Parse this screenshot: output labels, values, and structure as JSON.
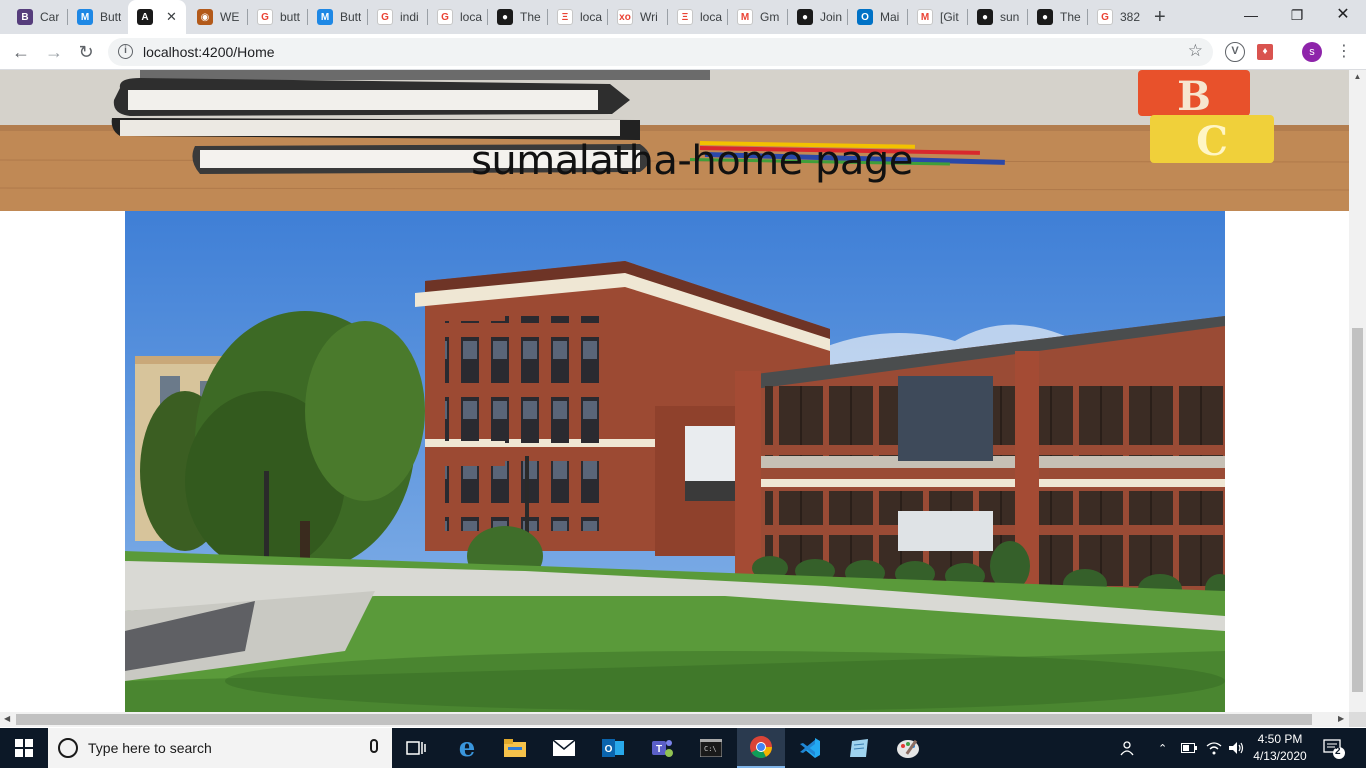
{
  "tabs": [
    {
      "title": "Car",
      "icon": "bootstrap-icon",
      "color": "#563d7c",
      "glyph": "B"
    },
    {
      "title": "Butt",
      "icon": "mui-icon",
      "color": "#1e88e5",
      "glyph": "M"
    },
    {
      "title": "",
      "icon": "angular-icon",
      "color": "#1a1a1a",
      "glyph": "A",
      "active": true
    },
    {
      "title": "WE",
      "icon": "owl-icon",
      "color": "#b35a1a",
      "glyph": "◉"
    },
    {
      "title": "butt",
      "icon": "google-icon",
      "color": "#ffffff",
      "glyph": "G"
    },
    {
      "title": "Butt",
      "icon": "mui-icon",
      "color": "#1e88e5",
      "glyph": "M"
    },
    {
      "title": "indi",
      "icon": "google-icon",
      "color": "#ffffff",
      "glyph": "G"
    },
    {
      "title": "loca",
      "icon": "google-icon",
      "color": "#ffffff",
      "glyph": "G"
    },
    {
      "title": "The",
      "icon": "github-icon",
      "color": "#1a1a1a",
      "glyph": "●"
    },
    {
      "title": "loca",
      "icon": "localhost-icon",
      "color": "#ffffff",
      "glyph": "Ξ"
    },
    {
      "title": "Wri",
      "icon": "xo-icon",
      "color": "#ffffff",
      "glyph": "xo"
    },
    {
      "title": "loca",
      "icon": "localhost-icon",
      "color": "#ffffff",
      "glyph": "Ξ"
    },
    {
      "title": "Gm",
      "icon": "gmail-icon",
      "color": "#ffffff",
      "glyph": "M"
    },
    {
      "title": "Join",
      "icon": "github-icon",
      "color": "#1a1a1a",
      "glyph": "●"
    },
    {
      "title": "Mai",
      "icon": "outlook-icon",
      "color": "#0072c6",
      "glyph": "O"
    },
    {
      "title": "[Git",
      "icon": "gmail-icon",
      "color": "#ffffff",
      "glyph": "M"
    },
    {
      "title": "sun",
      "icon": "github-icon",
      "color": "#1a1a1a",
      "glyph": "●"
    },
    {
      "title": "The",
      "icon": "github-icon",
      "color": "#1a1a1a",
      "glyph": "●"
    },
    {
      "title": "382",
      "icon": "google-icon",
      "color": "#ffffff",
      "glyph": "G"
    }
  ],
  "address_bar": {
    "url": "localhost:4200/Home"
  },
  "profile": {
    "initial": "s",
    "color": "#8e24aa"
  },
  "page": {
    "title": "sumalatha-home page"
  },
  "taskbar": {
    "search_placeholder": "Type here to search",
    "time": "4:50 PM",
    "date": "4/13/2020",
    "notifications": "2"
  }
}
